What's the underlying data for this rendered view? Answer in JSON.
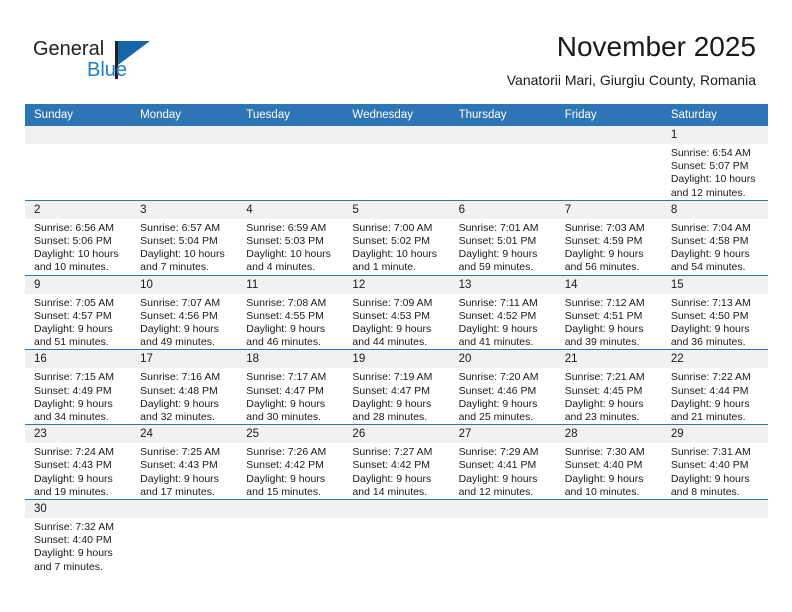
{
  "logo": {
    "text_general": "General",
    "text_blue": "Blue",
    "accent_color": "#1565a8"
  },
  "header": {
    "title": "November 2025",
    "subtitle": "Vanatorii Mari, Giurgiu County, Romania",
    "header_bg_color": "#2e75b6",
    "daynum_bg_color": "#f1f1f1"
  },
  "weekdays": [
    "Sunday",
    "Monday",
    "Tuesday",
    "Wednesday",
    "Thursday",
    "Friday",
    "Saturday"
  ],
  "labels": {
    "sunrise": "Sunrise:",
    "sunset": "Sunset:",
    "daylight": "Daylight:"
  },
  "weeks": [
    [
      {
        "day": "",
        "sunrise": "",
        "sunset": "",
        "daylight": "",
        "empty": true
      },
      {
        "day": "",
        "sunrise": "",
        "sunset": "",
        "daylight": "",
        "empty": true
      },
      {
        "day": "",
        "sunrise": "",
        "sunset": "",
        "daylight": "",
        "empty": true
      },
      {
        "day": "",
        "sunrise": "",
        "sunset": "",
        "daylight": "",
        "empty": true
      },
      {
        "day": "",
        "sunrise": "",
        "sunset": "",
        "daylight": "",
        "empty": true
      },
      {
        "day": "",
        "sunrise": "",
        "sunset": "",
        "daylight": "",
        "empty": true
      },
      {
        "day": "1",
        "sunrise": "Sunrise: 6:54 AM",
        "sunset": "Sunset: 5:07 PM",
        "daylight": "Daylight: 10 hours and 12 minutes.",
        "empty": false
      }
    ],
    [
      {
        "day": "2",
        "sunrise": "Sunrise: 6:56 AM",
        "sunset": "Sunset: 5:06 PM",
        "daylight": "Daylight: 10 hours and 10 minutes.",
        "empty": false
      },
      {
        "day": "3",
        "sunrise": "Sunrise: 6:57 AM",
        "sunset": "Sunset: 5:04 PM",
        "daylight": "Daylight: 10 hours and 7 minutes.",
        "empty": false
      },
      {
        "day": "4",
        "sunrise": "Sunrise: 6:59 AM",
        "sunset": "Sunset: 5:03 PM",
        "daylight": "Daylight: 10 hours and 4 minutes.",
        "empty": false
      },
      {
        "day": "5",
        "sunrise": "Sunrise: 7:00 AM",
        "sunset": "Sunset: 5:02 PM",
        "daylight": "Daylight: 10 hours and 1 minute.",
        "empty": false
      },
      {
        "day": "6",
        "sunrise": "Sunrise: 7:01 AM",
        "sunset": "Sunset: 5:01 PM",
        "daylight": "Daylight: 9 hours and 59 minutes.",
        "empty": false
      },
      {
        "day": "7",
        "sunrise": "Sunrise: 7:03 AM",
        "sunset": "Sunset: 4:59 PM",
        "daylight": "Daylight: 9 hours and 56 minutes.",
        "empty": false
      },
      {
        "day": "8",
        "sunrise": "Sunrise: 7:04 AM",
        "sunset": "Sunset: 4:58 PM",
        "daylight": "Daylight: 9 hours and 54 minutes.",
        "empty": false
      }
    ],
    [
      {
        "day": "9",
        "sunrise": "Sunrise: 7:05 AM",
        "sunset": "Sunset: 4:57 PM",
        "daylight": "Daylight: 9 hours and 51 minutes.",
        "empty": false
      },
      {
        "day": "10",
        "sunrise": "Sunrise: 7:07 AM",
        "sunset": "Sunset: 4:56 PM",
        "daylight": "Daylight: 9 hours and 49 minutes.",
        "empty": false
      },
      {
        "day": "11",
        "sunrise": "Sunrise: 7:08 AM",
        "sunset": "Sunset: 4:55 PM",
        "daylight": "Daylight: 9 hours and 46 minutes.",
        "empty": false
      },
      {
        "day": "12",
        "sunrise": "Sunrise: 7:09 AM",
        "sunset": "Sunset: 4:53 PM",
        "daylight": "Daylight: 9 hours and 44 minutes.",
        "empty": false
      },
      {
        "day": "13",
        "sunrise": "Sunrise: 7:11 AM",
        "sunset": "Sunset: 4:52 PM",
        "daylight": "Daylight: 9 hours and 41 minutes.",
        "empty": false
      },
      {
        "day": "14",
        "sunrise": "Sunrise: 7:12 AM",
        "sunset": "Sunset: 4:51 PM",
        "daylight": "Daylight: 9 hours and 39 minutes.",
        "empty": false
      },
      {
        "day": "15",
        "sunrise": "Sunrise: 7:13 AM",
        "sunset": "Sunset: 4:50 PM",
        "daylight": "Daylight: 9 hours and 36 minutes.",
        "empty": false
      }
    ],
    [
      {
        "day": "16",
        "sunrise": "Sunrise: 7:15 AM",
        "sunset": "Sunset: 4:49 PM",
        "daylight": "Daylight: 9 hours and 34 minutes.",
        "empty": false
      },
      {
        "day": "17",
        "sunrise": "Sunrise: 7:16 AM",
        "sunset": "Sunset: 4:48 PM",
        "daylight": "Daylight: 9 hours and 32 minutes.",
        "empty": false
      },
      {
        "day": "18",
        "sunrise": "Sunrise: 7:17 AM",
        "sunset": "Sunset: 4:47 PM",
        "daylight": "Daylight: 9 hours and 30 minutes.",
        "empty": false
      },
      {
        "day": "19",
        "sunrise": "Sunrise: 7:19 AM",
        "sunset": "Sunset: 4:47 PM",
        "daylight": "Daylight: 9 hours and 28 minutes.",
        "empty": false
      },
      {
        "day": "20",
        "sunrise": "Sunrise: 7:20 AM",
        "sunset": "Sunset: 4:46 PM",
        "daylight": "Daylight: 9 hours and 25 minutes.",
        "empty": false
      },
      {
        "day": "21",
        "sunrise": "Sunrise: 7:21 AM",
        "sunset": "Sunset: 4:45 PM",
        "daylight": "Daylight: 9 hours and 23 minutes.",
        "empty": false
      },
      {
        "day": "22",
        "sunrise": "Sunrise: 7:22 AM",
        "sunset": "Sunset: 4:44 PM",
        "daylight": "Daylight: 9 hours and 21 minutes.",
        "empty": false
      }
    ],
    [
      {
        "day": "23",
        "sunrise": "Sunrise: 7:24 AM",
        "sunset": "Sunset: 4:43 PM",
        "daylight": "Daylight: 9 hours and 19 minutes.",
        "empty": false
      },
      {
        "day": "24",
        "sunrise": "Sunrise: 7:25 AM",
        "sunset": "Sunset: 4:43 PM",
        "daylight": "Daylight: 9 hours and 17 minutes.",
        "empty": false
      },
      {
        "day": "25",
        "sunrise": "Sunrise: 7:26 AM",
        "sunset": "Sunset: 4:42 PM",
        "daylight": "Daylight: 9 hours and 15 minutes.",
        "empty": false
      },
      {
        "day": "26",
        "sunrise": "Sunrise: 7:27 AM",
        "sunset": "Sunset: 4:42 PM",
        "daylight": "Daylight: 9 hours and 14 minutes.",
        "empty": false
      },
      {
        "day": "27",
        "sunrise": "Sunrise: 7:29 AM",
        "sunset": "Sunset: 4:41 PM",
        "daylight": "Daylight: 9 hours and 12 minutes.",
        "empty": false
      },
      {
        "day": "28",
        "sunrise": "Sunrise: 7:30 AM",
        "sunset": "Sunset: 4:40 PM",
        "daylight": "Daylight: 9 hours and 10 minutes.",
        "empty": false
      },
      {
        "day": "29",
        "sunrise": "Sunrise: 7:31 AM",
        "sunset": "Sunset: 4:40 PM",
        "daylight": "Daylight: 9 hours and 8 minutes.",
        "empty": false
      }
    ],
    [
      {
        "day": "30",
        "sunrise": "Sunrise: 7:32 AM",
        "sunset": "Sunset: 4:40 PM",
        "daylight": "Daylight: 9 hours and 7 minutes.",
        "empty": false
      },
      {
        "day": "",
        "sunrise": "",
        "sunset": "",
        "daylight": "",
        "empty": true
      },
      {
        "day": "",
        "sunrise": "",
        "sunset": "",
        "daylight": "",
        "empty": true
      },
      {
        "day": "",
        "sunrise": "",
        "sunset": "",
        "daylight": "",
        "empty": true
      },
      {
        "day": "",
        "sunrise": "",
        "sunset": "",
        "daylight": "",
        "empty": true
      },
      {
        "day": "",
        "sunrise": "",
        "sunset": "",
        "daylight": "",
        "empty": true
      },
      {
        "day": "",
        "sunrise": "",
        "sunset": "",
        "daylight": "",
        "empty": true
      }
    ]
  ]
}
